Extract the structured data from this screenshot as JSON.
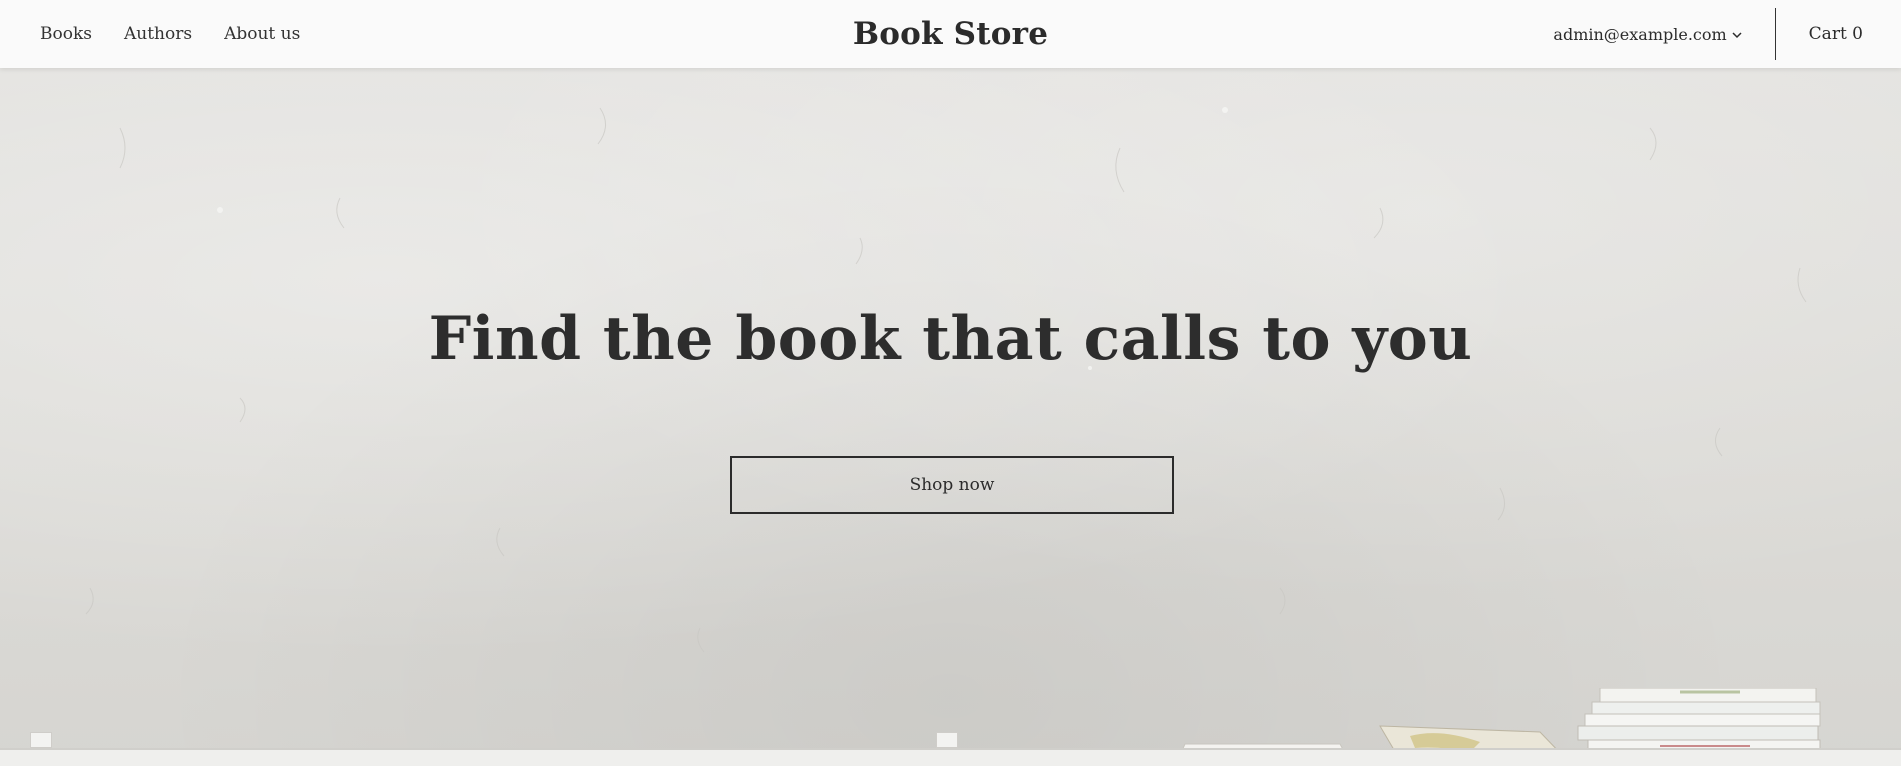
{
  "header": {
    "nav": [
      {
        "label": "Books"
      },
      {
        "label": "Authors"
      },
      {
        "label": "About us"
      }
    ],
    "brand": "Book Store",
    "account": "admin@example.com",
    "account_icon": "chevron-down-icon",
    "cart_label": "Cart 0"
  },
  "hero": {
    "title": "Find the book that calls to you",
    "cta_label": "Shop now"
  }
}
